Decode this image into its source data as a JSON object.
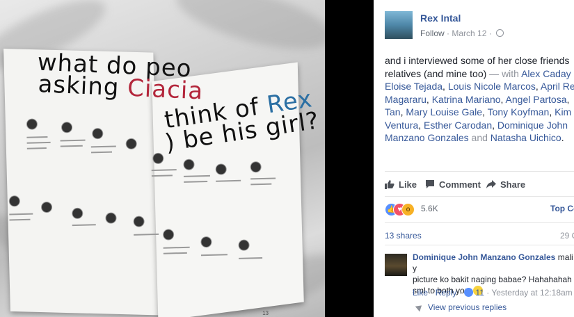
{
  "photo": {
    "headline_parts": [
      "what do peo",
      "asking ",
      "Ciacia",
      "think of ",
      "Rex",
      ") be his girl?"
    ],
    "page_number": "13"
  },
  "post": {
    "author": "Rex Intal",
    "follow_label": "Follow",
    "date": "March 12",
    "text_start": "and i interviewed some of her close friends",
    "text_relatives": "relatives (and mine too)",
    "with_label": " — with ",
    "tags": [
      "Alex Caday",
      "Eloise Tejada",
      "Louis Nicole Marcos",
      "April Re",
      "Magararu",
      "Katrina Mariano",
      "Angel Partosa",
      "Tan",
      "Mary Louise Gale",
      "Tony Koyfman",
      "Kim",
      "Ventura",
      "Esther Carodan",
      "Dominique John",
      "Manzano Gonzales",
      "Natasha Uichico"
    ],
    "and_label": " and "
  },
  "actions": {
    "like": "Like",
    "comment": "Comment",
    "share": "Share"
  },
  "reactions": {
    "count": "5.6K",
    "top_comments": "Top Co"
  },
  "shares": {
    "label": "13 shares",
    "comments_count": "29 C"
  },
  "comment": {
    "author": "Dominique John Manzano Gonzales",
    "text1": " mali y",
    "text2": "picture ko bakit naging babae? Hahahahah",
    "text3": "sml to both you",
    "like": "Like",
    "reply": "Reply",
    "likes_count": "11",
    "time": "Yesterday at 12:18am"
  },
  "view_previous": "View previous replies"
}
